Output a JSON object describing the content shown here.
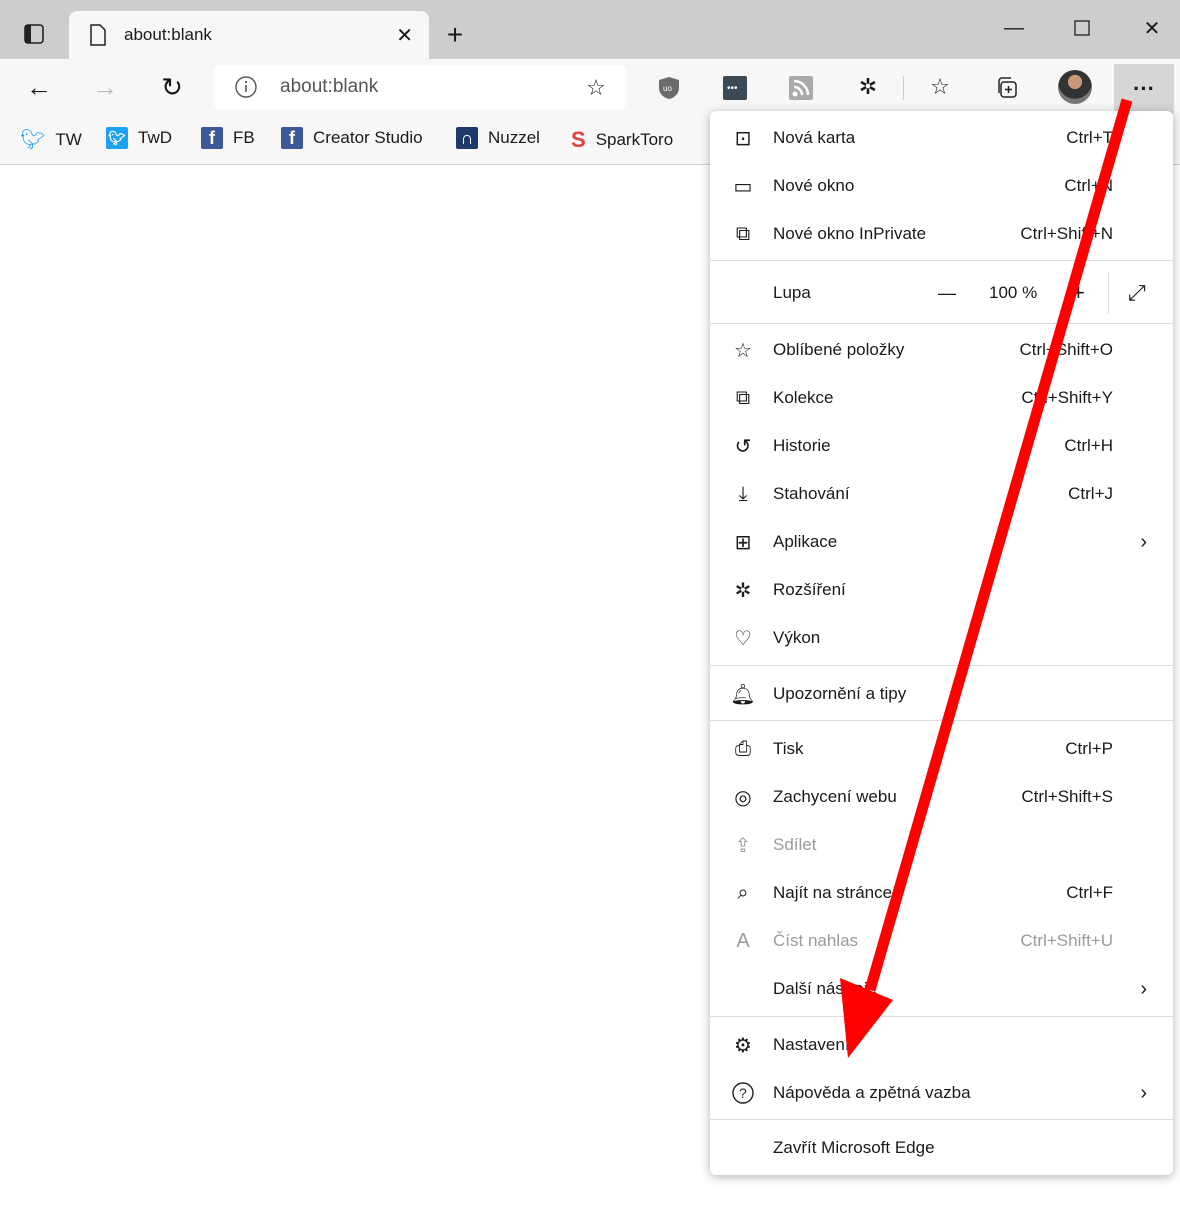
{
  "tab": {
    "title": "about:blank",
    "icon": "page-icon"
  },
  "window": {
    "minimize": "minimize-icon",
    "maximize": "maximize-icon",
    "close": "close-icon"
  },
  "address": {
    "url": "about:blank"
  },
  "bookmarks": [
    {
      "label": "TW",
      "icon": "twitter-icon",
      "color": "#1da1f2"
    },
    {
      "label": "TwD",
      "icon": "twitter-icon",
      "color": "#1da1f2"
    },
    {
      "label": "FB",
      "icon": "facebook-icon",
      "color": "#3b5998"
    },
    {
      "label": "Creator Studio",
      "icon": "facebook-icon",
      "color": "#3b5998"
    },
    {
      "label": "Nuzzel",
      "icon": "nuzzel-icon",
      "color": "#1d3a6b"
    },
    {
      "label": "SparkToro",
      "icon": "sparktoro-icon",
      "color": "#e0433a"
    }
  ],
  "menu": {
    "items": [
      {
        "label": "Nová karta",
        "shortcut": "Ctrl+T",
        "icon": "new-tab-icon"
      },
      {
        "label": "Nové okno",
        "shortcut": "Ctrl+N",
        "icon": "new-window-icon"
      },
      {
        "label": "Nové okno InPrivate",
        "shortcut": "Ctrl+Shift+N",
        "icon": "inprivate-icon"
      },
      {
        "label": "Oblíbené položky",
        "shortcut": "Ctrl+Shift+O",
        "icon": "favorites-icon"
      },
      {
        "label": "Kolekce",
        "shortcut": "Ctrl+Shift+Y",
        "icon": "collections-icon"
      },
      {
        "label": "Historie",
        "shortcut": "Ctrl+H",
        "icon": "history-icon"
      },
      {
        "label": "Stahování",
        "shortcut": "Ctrl+J",
        "icon": "download-icon"
      },
      {
        "label": "Aplikace",
        "shortcut": "",
        "icon": "apps-icon"
      },
      {
        "label": "Rozšíření",
        "shortcut": "",
        "icon": "extensions-icon"
      },
      {
        "label": "Výkon",
        "shortcut": "",
        "icon": "performance-icon"
      },
      {
        "label": "Upozornění a tipy",
        "shortcut": "",
        "icon": "bell-icon"
      },
      {
        "label": "Tisk",
        "shortcut": "Ctrl+P",
        "icon": "print-icon"
      },
      {
        "label": "Zachycení webu",
        "shortcut": "Ctrl+Shift+S",
        "icon": "web-capture-icon"
      },
      {
        "label": "Sdílet",
        "shortcut": "",
        "icon": "share-icon"
      },
      {
        "label": "Najít na stránce",
        "shortcut": "Ctrl+F",
        "icon": "find-icon"
      },
      {
        "label": "Číst nahlas",
        "shortcut": "Ctrl+Shift+U",
        "icon": "read-aloud-icon"
      },
      {
        "label": "Další nástroje",
        "shortcut": "",
        "icon": ""
      },
      {
        "label": "Nastavení",
        "shortcut": "",
        "icon": "settings-icon"
      },
      {
        "label": "Nápověda a zpětná vazba",
        "shortcut": "",
        "icon": "help-icon"
      },
      {
        "label": "Zavřít Microsoft Edge",
        "shortcut": "",
        "icon": ""
      }
    ],
    "zoom": {
      "label": "Lupa",
      "value": "100 %",
      "minus": "—",
      "plus": "+"
    }
  },
  "annotation": {
    "color": "#ff0000",
    "icon": "red-arrow"
  }
}
